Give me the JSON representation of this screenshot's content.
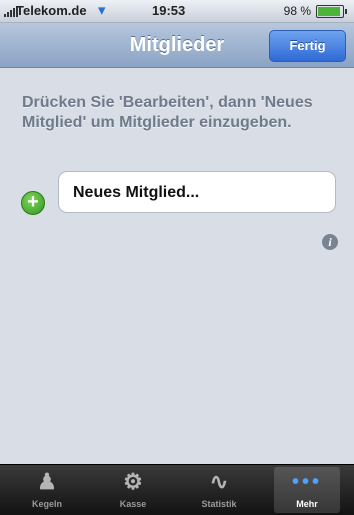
{
  "status_bar": {
    "carrier": "Telekom.de",
    "time": "19:53",
    "battery": "98 %",
    "battery_level": 0.98,
    "wifi_icon": "wifi-icon",
    "signal_icon": "signal-bars-icon"
  },
  "nav": {
    "title": "Mitglieder",
    "done_label": "Fertig"
  },
  "content": {
    "hint": "Drücken Sie 'Bearbeiten', dann 'Neues Mitglied' um Mitglieder einzugeben.",
    "new_member_label": "Neues Mitglied...",
    "add_icon": "plus-circle-icon",
    "info_icon": "info-icon",
    "info_glyph": "i"
  },
  "tabs": [
    {
      "label": "Kegeln",
      "icon": "bowling-pins-icon",
      "glyph": "♟",
      "selected": false
    },
    {
      "label": "Kasse",
      "icon": "coins-icon",
      "glyph": "⚙",
      "selected": false
    },
    {
      "label": "Statistik",
      "icon": "chart-curve-icon",
      "glyph": "∿",
      "selected": false
    },
    {
      "label": "Mehr",
      "icon": "more-dots-icon",
      "glyph": "•••",
      "selected": true
    }
  ],
  "colors": {
    "nav_bar": "#9fb3cf",
    "done_button": "#3b78e0",
    "add_icon": "#3fa82a",
    "tab_bar": "#1f1f1f",
    "selected_tab_icon": "#4aa3ff"
  }
}
